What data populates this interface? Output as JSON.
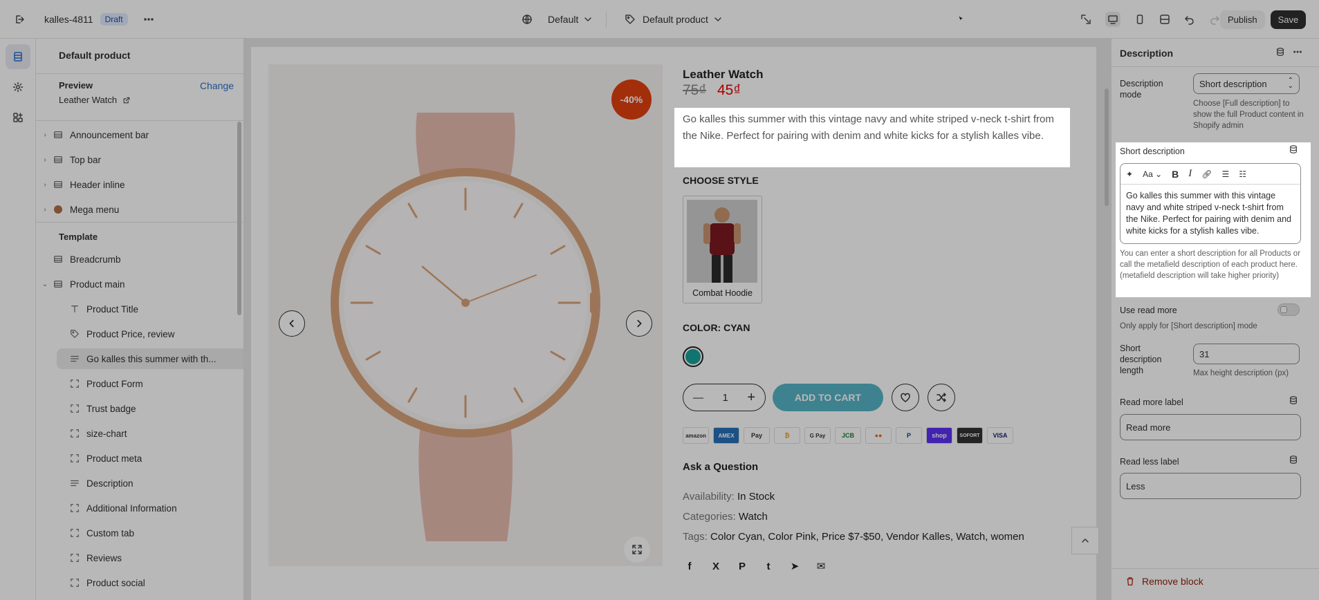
{
  "topbar": {
    "store_name": "kalles-4811",
    "status_badge": "Draft",
    "theme_select": "Default",
    "template_select": "Default product",
    "publish_label": "Publish",
    "save_label": "Save"
  },
  "left_panel": {
    "title": "Default product",
    "preview_label": "Preview",
    "change_label": "Change",
    "preview_value": "Leather Watch",
    "header_sections": [
      {
        "label": "Announcement bar",
        "icon": "section-icon"
      },
      {
        "label": "Top bar",
        "icon": "section-icon"
      },
      {
        "label": "Header inline",
        "icon": "section-icon"
      },
      {
        "label": "Mega menu",
        "icon": "app-icon"
      }
    ],
    "template_label": "Template",
    "template_sections": [
      {
        "label": "Breadcrumb",
        "icon": "section-icon"
      },
      {
        "label": "Product main",
        "icon": "section-icon"
      }
    ],
    "blocks": [
      {
        "label": "Product Title",
        "icon": "text-icon"
      },
      {
        "label": "Product Price, review",
        "icon": "price-tag-icon"
      },
      {
        "label": "Go kalles this summer with th...",
        "icon": "paragraph-icon"
      },
      {
        "label": "Product Form",
        "icon": "block-icon"
      },
      {
        "label": "Trust badge",
        "icon": "block-icon"
      },
      {
        "label": "size-chart",
        "icon": "block-icon"
      },
      {
        "label": "Product meta",
        "icon": "block-icon"
      },
      {
        "label": "Description",
        "icon": "paragraph-icon"
      },
      {
        "label": "Additional Information",
        "icon": "block-icon"
      },
      {
        "label": "Custom tab",
        "icon": "block-icon"
      },
      {
        "label": "Reviews",
        "icon": "block-icon"
      },
      {
        "label": "Product social",
        "icon": "block-icon"
      }
    ]
  },
  "product": {
    "sale_badge": "-40%",
    "title": "Leather Watch",
    "old_price": "75₫",
    "new_price": "45₫",
    "short_description": "Go kalles this summer with this vintage navy and white striped v-neck t-shirt from the Nike. Perfect for pairing with denim and white kicks for a stylish kalles vibe.",
    "choose_style_label": "CHOOSE STYLE",
    "style_option": "Combat Hoodie",
    "color_label": "COLOR: CYAN",
    "color_swatch": "#18a19a",
    "quantity": "1",
    "add_to_cart": "ADD TO CART",
    "payments": [
      "amazon",
      "AMEX",
      "Pay",
      "₿",
      "G Pay",
      "JCB",
      "●●",
      "P",
      "shop",
      "SOFORT",
      "VISA"
    ],
    "ask_question": "Ask a Question",
    "availability_label": "Availability:",
    "availability_value": "In Stock",
    "categories_label": "Categories:",
    "categories_value": "Watch",
    "tags_label": "Tags:",
    "tags_value": "Color Cyan, Color Pink, Price $7-$50, Vendor Kalles, Watch, women",
    "social": [
      "f",
      "X",
      "P",
      "t",
      "➤",
      "✉"
    ]
  },
  "right_panel": {
    "title": "Description",
    "desc_mode_label": "Description mode",
    "desc_mode_value": "Short description",
    "desc_mode_help": "Choose [Full description] to show the full Product content in Shopify admin",
    "short_desc_label": "Short description",
    "rte_format": "Aa",
    "short_desc_value": "Go kalles this summer with this vintage navy and white striped v-neck t-shirt from the Nike. Perfect for pairing with denim and white kicks for a stylish kalles vibe.",
    "short_desc_help": "You can enter a short description for all Products or call the metafield description of each product here. (metafield description will take higher priority)",
    "read_more_toggle_label": "Use read more",
    "read_more_help": "Only apply for [Short description] mode",
    "length_label": "Short description length",
    "length_value": "31",
    "length_help": "Max height description (px)",
    "read_more_label": "Read more label",
    "read_more_value": "Read more",
    "read_less_label": "Read less label",
    "read_less_value": "Less",
    "remove_block": "Remove block"
  }
}
